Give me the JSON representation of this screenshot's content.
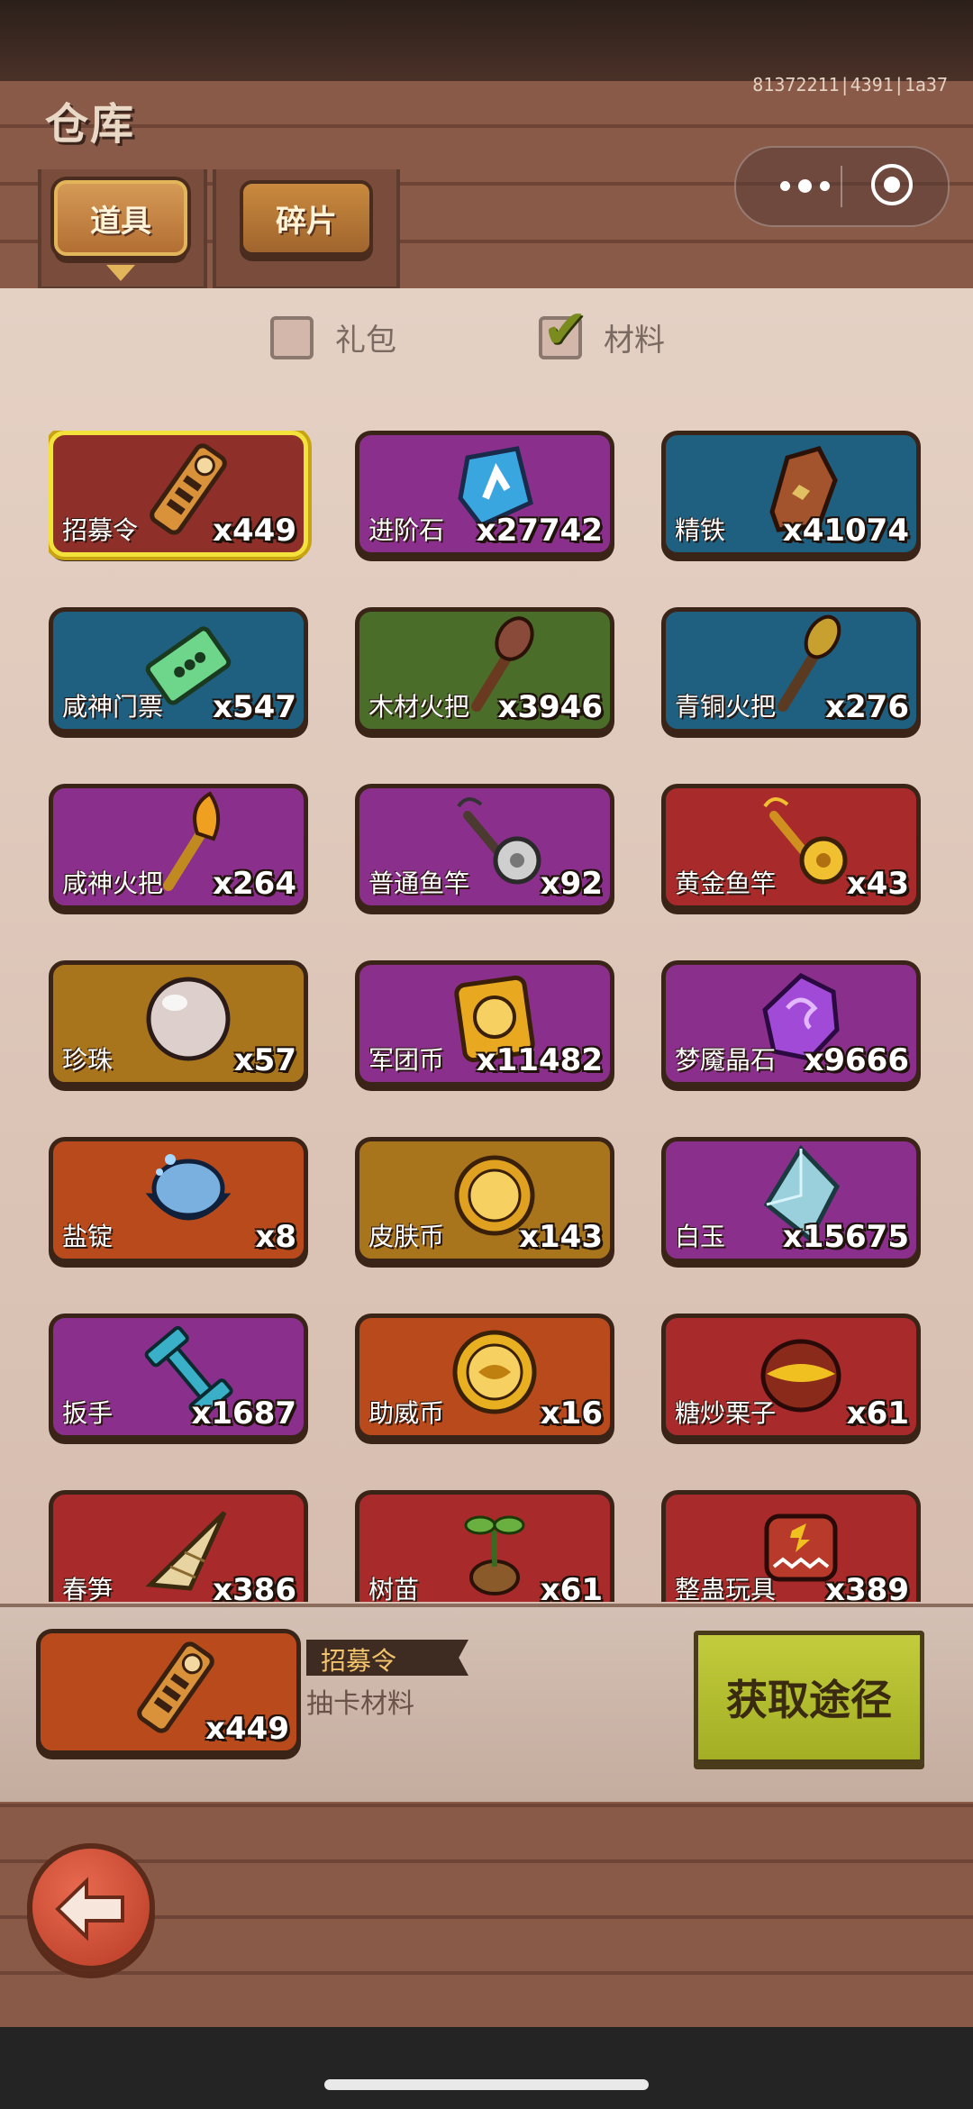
{
  "header": {
    "title": "仓库",
    "user_id": "81372211|4391|1a37"
  },
  "tabs": [
    {
      "label": "道具",
      "active": true
    },
    {
      "label": "碎片",
      "active": false
    }
  ],
  "filters": [
    {
      "label": "礼包",
      "checked": false
    },
    {
      "label": "材料",
      "checked": true
    }
  ],
  "items": [
    {
      "name": "招募令",
      "qty": "x449",
      "bg": "#8e2f2a",
      "icon": "recruit-token-icon",
      "selected": true
    },
    {
      "name": "进阶石",
      "qty": "x27742",
      "bg": "#8a2f8c",
      "icon": "advance-stone-icon"
    },
    {
      "name": "精铁",
      "qty": "x41074",
      "bg": "#1f5f80",
      "icon": "refined-iron-icon"
    },
    {
      "name": "咸神门票",
      "qty": "x547",
      "bg": "#1f5f80",
      "icon": "ticket-icon"
    },
    {
      "name": "木材火把",
      "qty": "x3946",
      "bg": "#4a6d2a",
      "icon": "wood-torch-icon"
    },
    {
      "name": "青铜火把",
      "qty": "x276",
      "bg": "#1f5f80",
      "icon": "bronze-torch-icon"
    },
    {
      "name": "咸神火把",
      "qty": "x264",
      "bg": "#8a2f8c",
      "icon": "divine-torch-icon"
    },
    {
      "name": "普通鱼竿",
      "qty": "x92",
      "bg": "#8a2f8c",
      "icon": "fishing-rod-icon"
    },
    {
      "name": "黄金鱼竿",
      "qty": "x43",
      "bg": "#a82a2a",
      "icon": "golden-rod-icon"
    },
    {
      "name": "珍珠",
      "qty": "x57",
      "bg": "#a8741c",
      "icon": "pearl-icon"
    },
    {
      "name": "军团币",
      "qty": "x11482",
      "bg": "#8a2f8c",
      "icon": "legion-coin-icon"
    },
    {
      "name": "梦魇晶石",
      "qty": "x9666",
      "bg": "#8a2f8c",
      "icon": "nightmare-crystal-icon"
    },
    {
      "name": "盐锭",
      "qty": "x8",
      "bg": "#b84a1c",
      "icon": "salt-ingot-icon"
    },
    {
      "name": "皮肤币",
      "qty": "x143",
      "bg": "#a8741c",
      "icon": "skin-coin-icon"
    },
    {
      "name": "白玉",
      "qty": "x15675",
      "bg": "#8a2f8c",
      "icon": "white-jade-icon"
    },
    {
      "name": "扳手",
      "qty": "x1687",
      "bg": "#8a2f8c",
      "icon": "wrench-icon"
    },
    {
      "name": "助威币",
      "qty": "x16",
      "bg": "#b84a1c",
      "icon": "cheer-coin-icon"
    },
    {
      "name": "糖炒栗子",
      "qty": "x61",
      "bg": "#a82a2a",
      "icon": "chestnut-icon"
    },
    {
      "name": "春笋",
      "qty": "x386",
      "bg": "#a82a2a",
      "icon": "bamboo-shoot-icon"
    },
    {
      "name": "树苗",
      "qty": "x61",
      "bg": "#a82a2a",
      "icon": "sapling-icon"
    },
    {
      "name": "整蛊玩具",
      "qty": "x389",
      "bg": "#a82a2a",
      "icon": "prank-toy-icon"
    }
  ],
  "selected": {
    "name": "招募令",
    "desc": "抽卡材料",
    "qty": "x449",
    "bg": "#b84a1c",
    "icon": "recruit-token-icon"
  },
  "obtain_button": "获取途径",
  "back_icon": "back-arrow-icon"
}
